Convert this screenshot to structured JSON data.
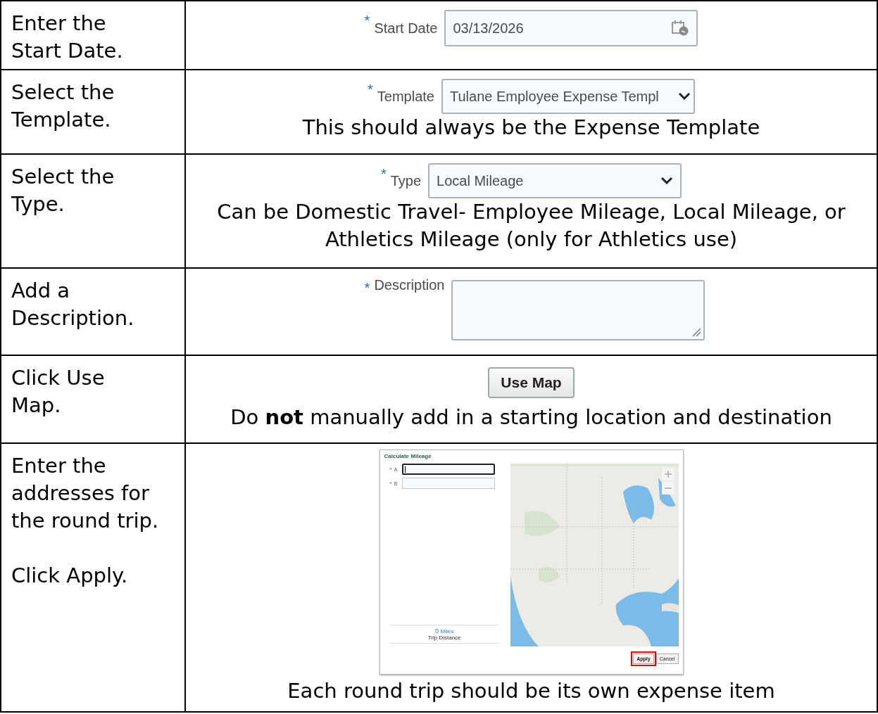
{
  "rows": [
    {
      "instruction": "Enter the\nStart Date.",
      "kind": "date",
      "field": {
        "mark": "*",
        "label": "Start Date",
        "value": "03/13/2026"
      }
    },
    {
      "instruction": "Select the\nTemplate.",
      "kind": "select",
      "field": {
        "mark": "*",
        "label": "Template",
        "value": "Tulane Employee Expense Templ"
      },
      "note": "This should always be the Expense Template"
    },
    {
      "instruction": "Select the\nType.",
      "kind": "select",
      "field": {
        "mark": "*",
        "label": "Type",
        "value": "Local Mileage"
      },
      "note": "Can be Domestic Travel- Employee Mileage, Local Mileage, or Athletics Mileage (only for Athletics use)"
    },
    {
      "instruction": "Add a\nDescription.",
      "kind": "textarea",
      "field": {
        "mark": "*",
        "label": "Description"
      }
    },
    {
      "instruction": "Click Use\nMap.",
      "kind": "button",
      "button": "Use Map",
      "note": "Do **not** manually add in a starting location and destination"
    },
    {
      "instruction": "Enter the\naddresses for\nthe round trip.\n\nClick Apply.",
      "kind": "dialog",
      "dialog": {
        "title": "Calculate Mileage",
        "fields": [
          {
            "mark": "*",
            "label": "A",
            "focused": true
          },
          {
            "mark": "*",
            "label": "B",
            "focused": false
          }
        ],
        "distance": "0",
        "unit": "Miles",
        "distance_label": "Trip Distance",
        "buttons": [
          {
            "label": "Apply",
            "highlighted": true
          },
          {
            "label": "Cancel",
            "highlighted": false
          }
        ]
      },
      "note": "Each round trip should be its own expense item"
    }
  ]
}
